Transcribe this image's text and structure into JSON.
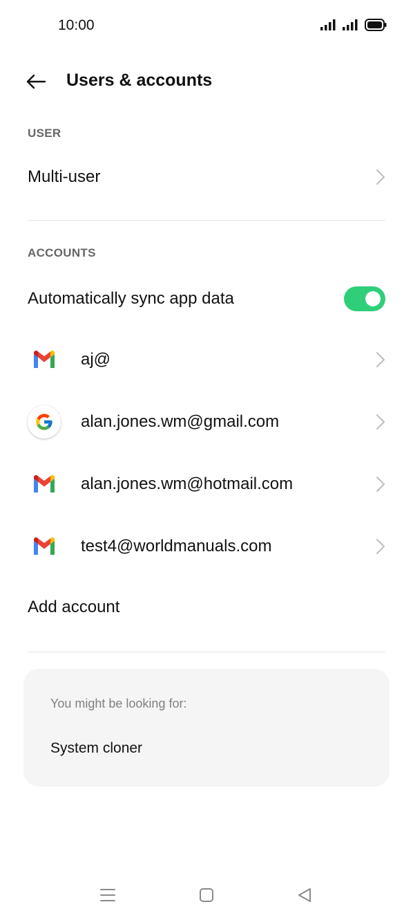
{
  "status_bar": {
    "time": "10:00"
  },
  "header": {
    "title": "Users & accounts"
  },
  "sections": {
    "user_label": "USER",
    "accounts_label": "ACCOUNTS"
  },
  "user": {
    "multi_user_label": "Multi-user"
  },
  "accounts": {
    "sync_label": "Automatically sync app data",
    "sync_enabled": true,
    "items": [
      {
        "label": "aj@",
        "icon": "gmail-icon"
      },
      {
        "label": "alan.jones.wm@gmail.com",
        "icon": "google-icon"
      },
      {
        "label": "alan.jones.wm@hotmail.com",
        "icon": "gmail-icon"
      },
      {
        "label": "test4@worldmanuals.com",
        "icon": "gmail-icon"
      }
    ],
    "add_account_label": "Add account"
  },
  "suggestions": {
    "title": "You might be looking for:",
    "item": "System cloner"
  },
  "colors": {
    "toggle_on": "#2fcf7a",
    "card_bg": "#f5f5f5"
  }
}
